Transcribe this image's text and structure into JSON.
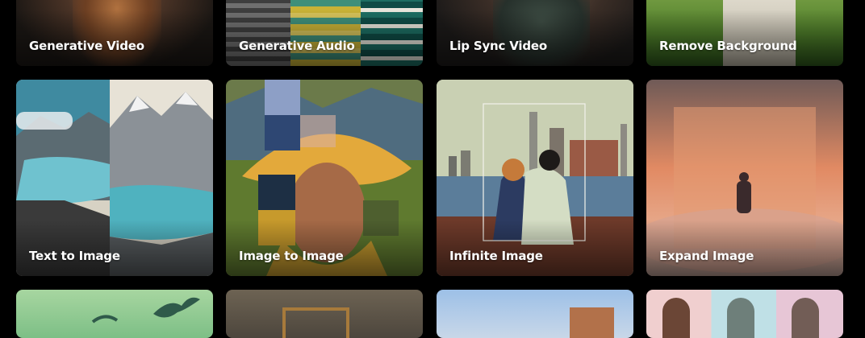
{
  "tools": [
    {
      "label": "Generative Video"
    },
    {
      "label": "Generative Audio"
    },
    {
      "label": "Lip Sync Video"
    },
    {
      "label": "Remove Background"
    },
    {
      "label": "Text to Image"
    },
    {
      "label": "Image to Image"
    },
    {
      "label": "Infinite Image"
    },
    {
      "label": "Expand Image"
    }
  ]
}
